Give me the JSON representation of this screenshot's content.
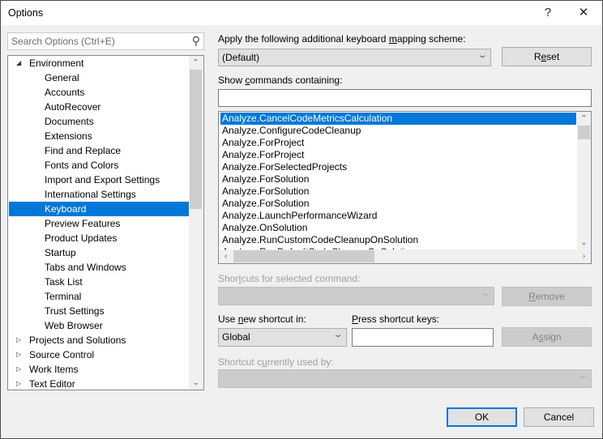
{
  "window": {
    "title": "Options",
    "help": "?",
    "close": "✕"
  },
  "search": {
    "placeholder": "Search Options (Ctrl+E)",
    "icon": "search-icon"
  },
  "tree": {
    "items": [
      {
        "label": "Environment",
        "level": 0,
        "expander": "expanded"
      },
      {
        "label": "General",
        "level": 1
      },
      {
        "label": "Accounts",
        "level": 1
      },
      {
        "label": "AutoRecover",
        "level": 1
      },
      {
        "label": "Documents",
        "level": 1
      },
      {
        "label": "Extensions",
        "level": 1
      },
      {
        "label": "Find and Replace",
        "level": 1
      },
      {
        "label": "Fonts and Colors",
        "level": 1
      },
      {
        "label": "Import and Export Settings",
        "level": 1
      },
      {
        "label": "International Settings",
        "level": 1
      },
      {
        "label": "Keyboard",
        "level": 1,
        "selected": true
      },
      {
        "label": "Preview Features",
        "level": 1
      },
      {
        "label": "Product Updates",
        "level": 1
      },
      {
        "label": "Startup",
        "level": 1
      },
      {
        "label": "Tabs and Windows",
        "level": 1
      },
      {
        "label": "Task List",
        "level": 1
      },
      {
        "label": "Terminal",
        "level": 1
      },
      {
        "label": "Trust Settings",
        "level": 1
      },
      {
        "label": "Web Browser",
        "level": 1
      },
      {
        "label": "Projects and Solutions",
        "level": 0,
        "expander": "collapsed"
      },
      {
        "label": "Source Control",
        "level": 0,
        "expander": "collapsed"
      },
      {
        "label": "Work Items",
        "level": 0,
        "expander": "collapsed"
      },
      {
        "label": "Text Editor",
        "level": 0,
        "expander": "collapsed"
      }
    ]
  },
  "mapping": {
    "label": {
      "pre": "Apply the following additional keyboard ",
      "key": "m",
      "post": "apping scheme:"
    },
    "value": "(Default)",
    "reset": {
      "pre": "R",
      "key": "e",
      "post": "set"
    }
  },
  "commands": {
    "label": {
      "pre": "Show ",
      "key": "c",
      "post": "ommands containing:"
    },
    "value": "",
    "items": [
      "Analyze.CancelCodeMetricsCalculation",
      "Analyze.ConfigureCodeCleanup",
      "Analyze.ForProject",
      "Analyze.ForProject",
      "Analyze.ForSelectedProjects",
      "Analyze.ForSolution",
      "Analyze.ForSolution",
      "Analyze.ForSolution",
      "Analyze.LaunchPerformanceWizard",
      "Analyze.OnSolution",
      "Analyze.RunCustomCodeCleanupOnSolution",
      "Analyze.RunDefaultCodeCleanupOnSolution"
    ],
    "selected_index": 0
  },
  "shortcuts": {
    "label": {
      "pre": "Shor",
      "key": "t",
      "post": "cuts for selected command:"
    },
    "value": "",
    "remove": {
      "pre": "",
      "key": "R",
      "post": "emove"
    }
  },
  "use_in": {
    "label": {
      "pre": "Use ",
      "key": "n",
      "post": "ew shortcut in:"
    },
    "value": "Global"
  },
  "press_keys": {
    "label": {
      "pre": "",
      "key": "P",
      "post": "ress shortcut keys:"
    },
    "value": "",
    "assign": {
      "pre": "A",
      "key": "s",
      "post": "sign"
    }
  },
  "used_by": {
    "label": {
      "pre": "Shortcut c",
      "key": "u",
      "post": "rrently used by:"
    },
    "value": ""
  },
  "footer": {
    "ok": "OK",
    "cancel": "Cancel"
  },
  "colors": {
    "selection": "#0078d7",
    "disabled_text": "#a0a0a0"
  }
}
